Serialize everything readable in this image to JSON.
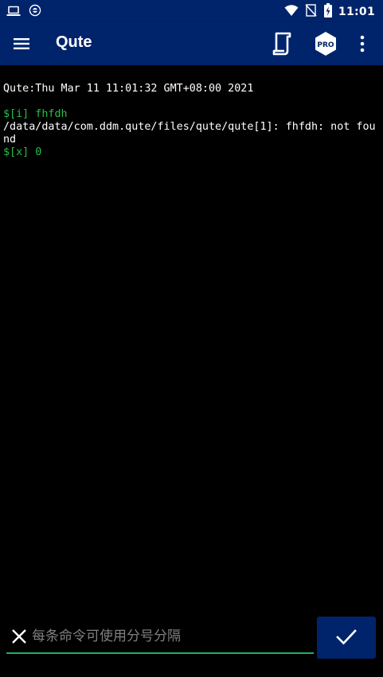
{
  "status_bar": {
    "time": "11:01",
    "left_icons": [
      "laptop-icon",
      "vpn-icon"
    ],
    "right_icons": [
      "wifi-icon",
      "signal-off-icon",
      "battery-charging-icon"
    ]
  },
  "app_bar": {
    "title": "Qute",
    "menu_icon": "menu-icon",
    "actions": [
      "terminal-icon",
      "pro-icon",
      "more-vert-icon"
    ],
    "pro_badge": "PRO"
  },
  "terminal": {
    "lines": [
      {
        "text": "Qute:Thu Mar 11 11:01:32 GMT+08:00 2021",
        "color": "#ffffff"
      },
      {
        "text": "",
        "color": "#ffffff"
      },
      {
        "text": "$[i] fhfdh",
        "color": "#22c04a"
      },
      {
        "text": "/data/data/com.ddm.qute/files/qute/qute[1]: fhfdh: not found",
        "color": "#ffffff"
      },
      {
        "text": "$[x] 0",
        "color": "#22c04a"
      }
    ]
  },
  "input": {
    "value": "",
    "placeholder": "每条命令可使用分号分隔",
    "clear_icon": "close-icon"
  },
  "submit": {
    "icon": "check-icon"
  },
  "colors": {
    "bar_bg": "#00246b",
    "accent_green": "#22c04a",
    "background": "#000000"
  }
}
